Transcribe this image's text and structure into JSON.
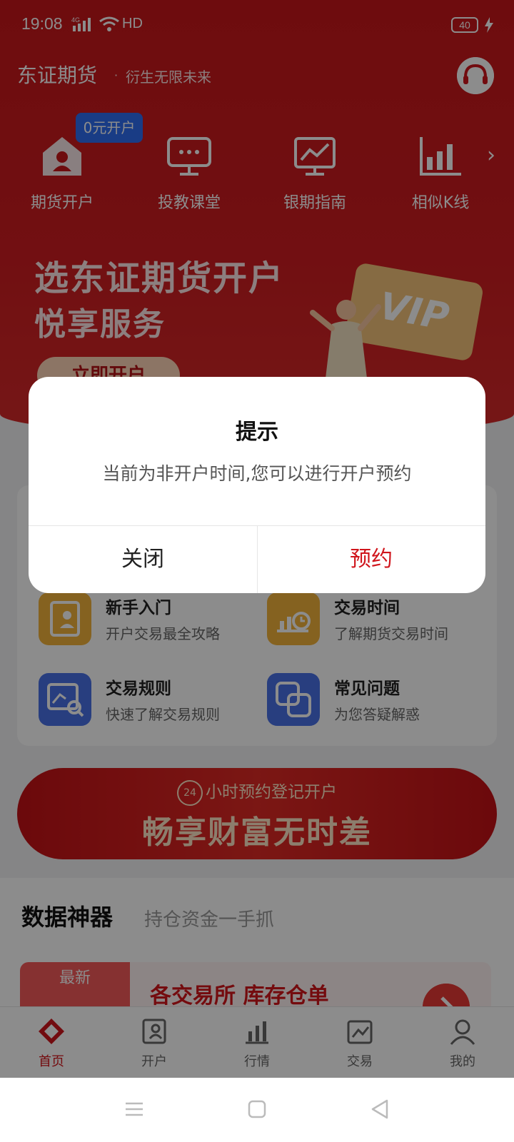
{
  "status_bar": {
    "time": "19:08",
    "network": "4G",
    "hd": "HD",
    "battery": "40"
  },
  "header": {
    "brand": "东证期货",
    "separator": "·",
    "slogan": "衍生无限未来"
  },
  "quick_menu": {
    "badge": "0元开户",
    "items": [
      {
        "label": "期货开户",
        "icon": "account-house-icon"
      },
      {
        "label": "投教课堂",
        "icon": "classroom-screen-icon"
      },
      {
        "label": "银期指南",
        "icon": "chart-monitor-icon"
      },
      {
        "label": "相似K线",
        "icon": "k-line-chart-icon"
      }
    ],
    "more_arrow": "›"
  },
  "banner": {
    "title_line1": "选东证期货开户",
    "title_line2": "悦享服务",
    "button": "立即开户",
    "vip": "VIP"
  },
  "guides": [
    {
      "title": "新手入门",
      "subtitle": "开户交易最全攻略",
      "color": "#f2b33b"
    },
    {
      "title": "交易时间",
      "subtitle": "了解期货交易时间",
      "color": "#f2b33b"
    },
    {
      "title": "交易规则",
      "subtitle": "快速了解交易规则",
      "color": "#4a72e8"
    },
    {
      "title": "常见问题",
      "subtitle": "为您答疑解惑",
      "color": "#4a72e8"
    }
  ],
  "promo": {
    "badge": "24",
    "top": "小时预约登记开户",
    "main": "畅享财富无时差"
  },
  "data_section": {
    "title": "数据神器",
    "subtitle": "持仓资金一手抓",
    "tag": "最新",
    "card_title": "各交易所 库存仓单"
  },
  "bottom_nav": [
    {
      "label": "首页",
      "active": true
    },
    {
      "label": "开户",
      "active": false
    },
    {
      "label": "行情",
      "active": false
    },
    {
      "label": "交易",
      "active": false
    },
    {
      "label": "我的",
      "active": false
    }
  ],
  "dialog": {
    "title": "提示",
    "message": "当前为非开户时间,您可以进行开户预约",
    "close_label": "关闭",
    "reserve_label": "预约"
  },
  "colors": {
    "brand_red": "#c9171b",
    "accent_red": "#d0151c",
    "badge_blue": "#2f6df2"
  }
}
